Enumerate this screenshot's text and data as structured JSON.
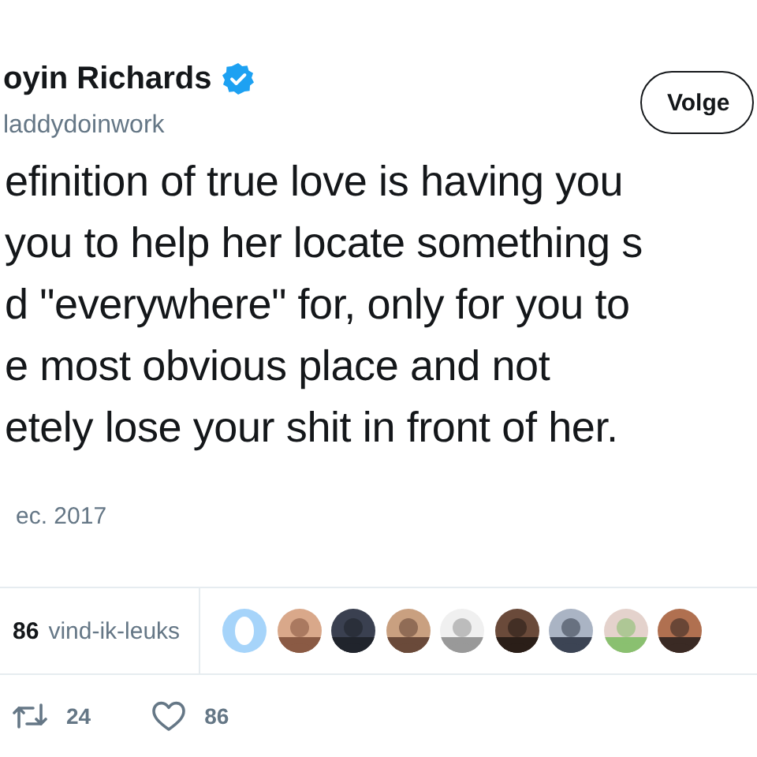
{
  "author": {
    "name": "oyin Richards",
    "verified": true,
    "handle": "laddydoinwork"
  },
  "follow_button": {
    "label": "Volge"
  },
  "tweet": {
    "lines": [
      "efinition of true love is having you",
      "you to help her locate something s",
      "d \"everywhere\" for, only for you to",
      "e most obvious place and not",
      "etely lose your shit in front of her."
    ]
  },
  "date": "ec. 2017",
  "likes": {
    "count": "86",
    "label": "vind-ik-leuks",
    "likers": [
      {
        "kind": "default"
      },
      {
        "kind": "picture"
      },
      {
        "kind": "picture"
      },
      {
        "kind": "picture"
      },
      {
        "kind": "picture"
      },
      {
        "kind": "picture"
      },
      {
        "kind": "picture"
      },
      {
        "kind": "picture"
      },
      {
        "kind": "picture"
      }
    ]
  },
  "actions": [
    {
      "kind": "retweet",
      "count": "24"
    },
    {
      "kind": "like",
      "count": "86"
    }
  ]
}
